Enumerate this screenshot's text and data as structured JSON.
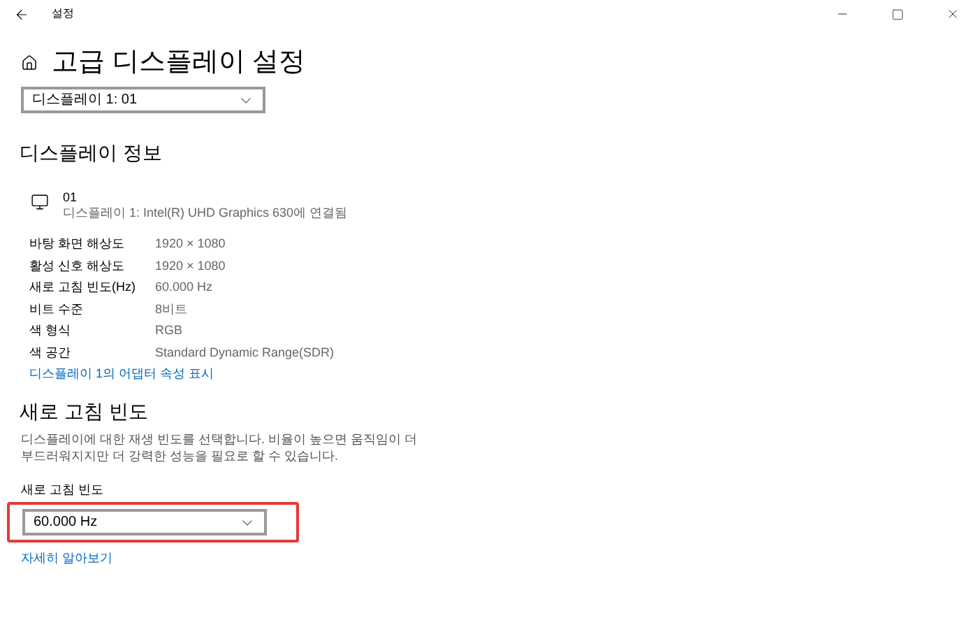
{
  "window": {
    "title": "설정"
  },
  "page": {
    "title": "고급 디스플레이 설정"
  },
  "display_select": {
    "value": "디스플레이 1: 01"
  },
  "display_info": {
    "heading": "디스플레이 정보",
    "monitor_name": "01",
    "monitor_detail": "디스플레이 1: Intel(R) UHD Graphics 630에 연결됨",
    "rows": [
      {
        "label": "바탕 화면 해상도",
        "value": "1920 × 1080"
      },
      {
        "label": "활성 신호 해상도",
        "value": "1920 × 1080"
      },
      {
        "label": "새로 고침 빈도(Hz)",
        "value": "60.000 Hz"
      },
      {
        "label": "비트 수준",
        "value": "8비트"
      },
      {
        "label": "색 형식",
        "value": "RGB"
      },
      {
        "label": "색 공간",
        "value": "Standard Dynamic Range(SDR)"
      }
    ],
    "link": "디스플레이 1의 어댑터 속성 표시"
  },
  "refresh_rate": {
    "heading": "새로 고침 빈도",
    "description": "디스플레이에 대한 재생 빈도를 선택합니다. 비율이 높으면 움직임이 더 부드러워지지만 더 강력한 성능을 필요로 할 수 있습니다.",
    "label": "새로 고침 빈도",
    "value": "60.000 Hz",
    "highlighted": true,
    "link": "자세히 알아보기"
  }
}
